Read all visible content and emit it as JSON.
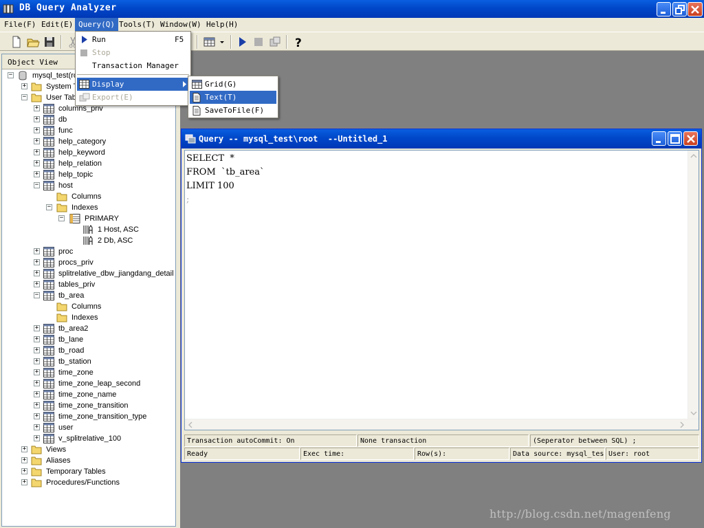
{
  "window": {
    "title": "DB Query Analyzer"
  },
  "menubar": [
    {
      "label": "File(F)"
    },
    {
      "label": "Edit(E)"
    },
    {
      "label": "Query(Q)"
    },
    {
      "label": "Tools(T)"
    },
    {
      "label": "Window(W)"
    },
    {
      "label": "Help(H)"
    }
  ],
  "query_menu": {
    "items": [
      {
        "label": "Run",
        "shortcut": "F5"
      },
      {
        "label": "Stop"
      },
      {
        "label": "Transaction Manager"
      },
      {
        "label": "Display"
      },
      {
        "label": "Export(E)"
      }
    ]
  },
  "display_submenu": {
    "items": [
      {
        "label": "Grid(G)"
      },
      {
        "label": "Text(T)"
      },
      {
        "label": "SaveToFile(F)"
      }
    ]
  },
  "object_view": {
    "header": "Object View",
    "tree": [
      {
        "label": "mysql_test(ro",
        "icon": "database-icon"
      },
      {
        "label": "System T",
        "icon": "folder-icon"
      },
      {
        "label": "User Tab",
        "icon": "folder-icon"
      },
      {
        "label": "columns_priv",
        "icon": "table-icon"
      },
      {
        "label": "db",
        "icon": "table-icon"
      },
      {
        "label": "func",
        "icon": "table-icon"
      },
      {
        "label": "help_category",
        "icon": "table-icon"
      },
      {
        "label": "help_keyword",
        "icon": "table-icon"
      },
      {
        "label": "help_relation",
        "icon": "table-icon"
      },
      {
        "label": "help_topic",
        "icon": "table-icon"
      },
      {
        "label": "host",
        "icon": "table-icon"
      },
      {
        "label": "Columns",
        "icon": "folder-icon"
      },
      {
        "label": "Indexes",
        "icon": "folder-icon"
      },
      {
        "label": "PRIMARY",
        "icon": "index-icon"
      },
      {
        "label": "1  Host, ASC",
        "icon": "sort-asc-icon"
      },
      {
        "label": "2  Db, ASC",
        "icon": "sort-asc-icon"
      },
      {
        "label": "proc",
        "icon": "table-icon"
      },
      {
        "label": "procs_priv",
        "icon": "table-icon"
      },
      {
        "label": "splitrelative_dbw_jiangdang_detail",
        "icon": "table-icon"
      },
      {
        "label": "tables_priv",
        "icon": "table-icon"
      },
      {
        "label": "tb_area",
        "icon": "table-icon"
      },
      {
        "label": "Columns",
        "icon": "folder-icon"
      },
      {
        "label": "Indexes",
        "icon": "folder-icon"
      },
      {
        "label": "tb_area2",
        "icon": "table-icon"
      },
      {
        "label": "tb_lane",
        "icon": "table-icon"
      },
      {
        "label": "tb_road",
        "icon": "table-icon"
      },
      {
        "label": "tb_station",
        "icon": "table-icon"
      },
      {
        "label": "time_zone",
        "icon": "table-icon"
      },
      {
        "label": "time_zone_leap_second",
        "icon": "table-icon"
      },
      {
        "label": "time_zone_name",
        "icon": "table-icon"
      },
      {
        "label": "time_zone_transition",
        "icon": "table-icon"
      },
      {
        "label": "time_zone_transition_type",
        "icon": "table-icon"
      },
      {
        "label": "user",
        "icon": "table-icon"
      },
      {
        "label": "v_splitrelative_100",
        "icon": "table-icon"
      },
      {
        "label": "Views",
        "icon": "folder-icon"
      },
      {
        "label": "Aliases",
        "icon": "folder-icon"
      },
      {
        "label": "Temporary Tables",
        "icon": "folder-icon"
      },
      {
        "label": "Procedures/Functions",
        "icon": "folder-icon"
      }
    ]
  },
  "query_window": {
    "title": "Query -- mysql_test\\root  --Untitled_1",
    "code": [
      "SELECT  *",
      "FROM  `tb_area`",
      "LIMIT 100",
      ";"
    ]
  },
  "status": {
    "row1": [
      "Transaction autoCommit: On",
      "None transaction",
      "(Seperator between SQL)   ;"
    ],
    "row2": [
      "Ready",
      "Exec time:",
      "Row(s):",
      "Data source: mysql_test",
      "User: root"
    ]
  },
  "watermark": "http://blog.csdn.net/magenfeng",
  "colors": {
    "titlebar": "#0047c9",
    "selection": "#316ac5",
    "mdi_background": "#808080"
  }
}
